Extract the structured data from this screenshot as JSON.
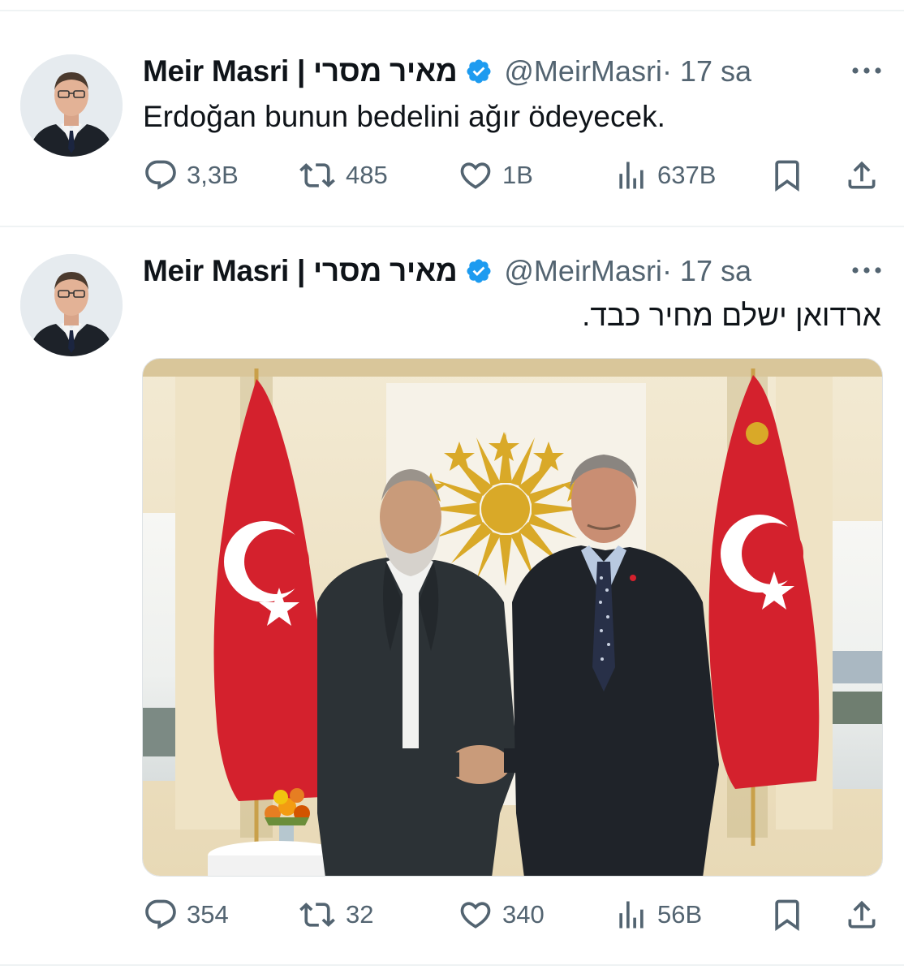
{
  "tweets": [
    {
      "author_name": "Meir Masri | מאיר מסרי",
      "handle": "@MeirMasri",
      "time": " · 17 sa",
      "text": "Erdoğan bunun bedelini ağır ödeyecek.",
      "replies": "3,3B",
      "retweets": "485",
      "likes": "1B",
      "views": "637B"
    },
    {
      "author_name": "Meir Masri | מאיר מסרי",
      "handle": "@MeirMasri",
      "time": " · 17 sa",
      "text": "ארדואן ישלם מחיר כבד.",
      "replies": "354",
      "retweets": "32",
      "likes": "340",
      "views": "56B"
    }
  ],
  "icons": {
    "verified": "verified-badge-icon",
    "more": "more-options-icon",
    "reply": "reply-icon",
    "retweet": "retweet-icon",
    "like": "like-heart-icon",
    "views": "views-chart-icon",
    "bookmark": "bookmark-icon",
    "share": "share-icon"
  },
  "colors": {
    "text_primary": "#0f1419",
    "text_secondary": "#536471",
    "verified_blue": "#1d9bf0",
    "divider": "#eff3f4",
    "flag_red": "#d4212d"
  }
}
